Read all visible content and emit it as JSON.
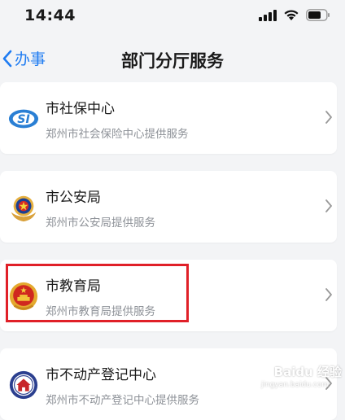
{
  "status_bar": {
    "time": "14:44"
  },
  "nav": {
    "back_label": "办事",
    "title": "部门分厅服务"
  },
  "services": [
    {
      "name": "市社保中心",
      "provider": "郑州市社会保险中心提供服务",
      "icon": "si-logo-icon"
    },
    {
      "name": "市公安局",
      "provider": "郑州市公安局提供服务",
      "icon": "police-badge-icon"
    },
    {
      "name": "市教育局",
      "provider": "郑州市教育局提供服务",
      "icon": "national-emblem-icon"
    },
    {
      "name": "市不动产登记中心",
      "provider": "郑州市不动产登记中心提供服务",
      "icon": "real-estate-seal-icon"
    }
  ],
  "highlighted_item": "市教育局",
  "watermark": {
    "text": "Baidu 经验",
    "sub": "jingyan.baidu.com"
  },
  "colors": {
    "accent": "#1f7cf2",
    "highlight": "#e02028",
    "background": "#f3f4f6",
    "subtext": "#8e9298"
  }
}
